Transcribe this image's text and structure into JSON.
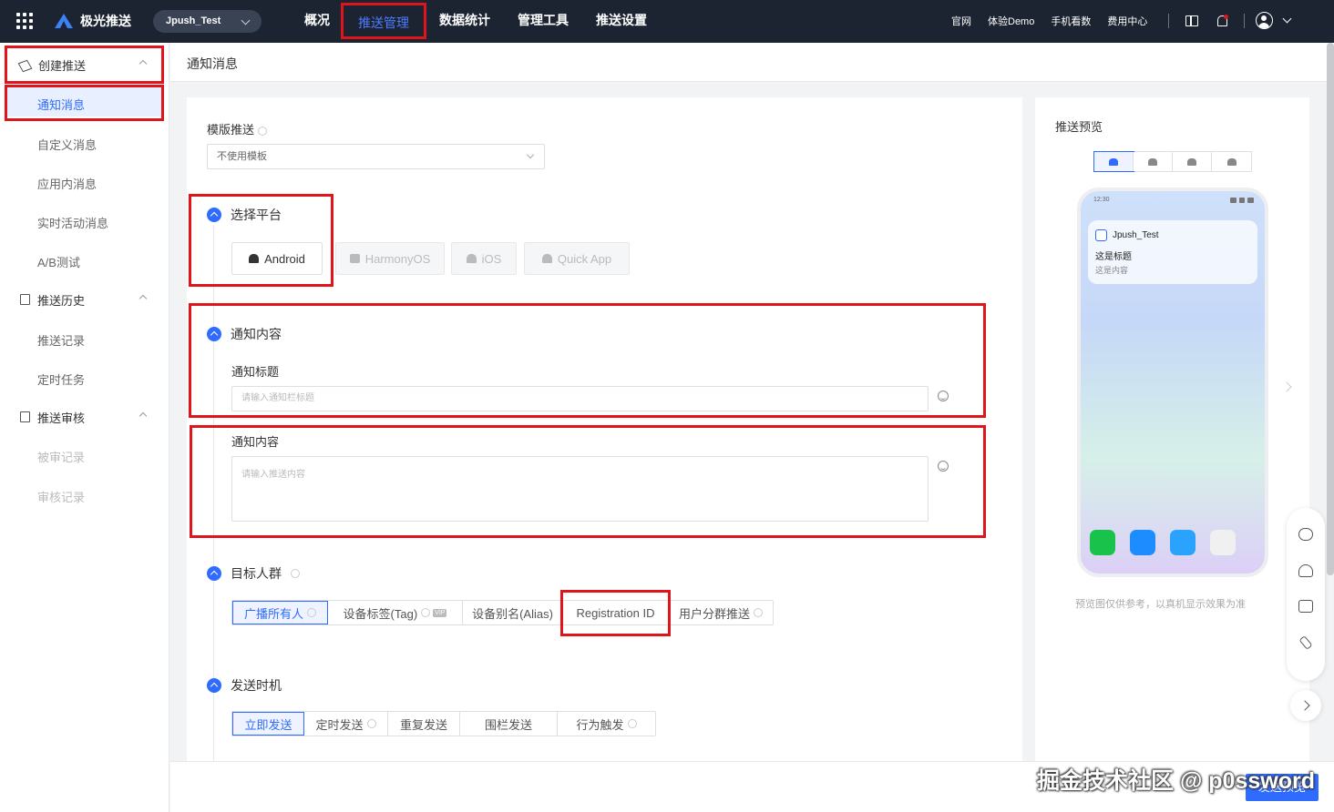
{
  "topbar": {
    "brand": "极光推送",
    "app_select": "Jpush_Test",
    "nav": [
      "概况",
      "推送管理",
      "数据统计",
      "管理工具",
      "推送设置"
    ],
    "links": [
      "官网",
      "体验Demo",
      "手机看数",
      "费用中心"
    ]
  },
  "sidebar": {
    "group1": "创建推送",
    "group1_items": [
      "通知消息",
      "自定义消息",
      "应用内消息",
      "实时活动消息",
      "A/B测试"
    ],
    "group2": "推送历史",
    "group2_items": [
      "推送记录",
      "定时任务"
    ],
    "group3": "推送审核",
    "group3_items": [
      "被审记录",
      "审核记录"
    ]
  },
  "main": {
    "breadcrumb": "通知消息",
    "template_label": "模版推送",
    "template_value": "不使用模板",
    "platform_title": "选择平台",
    "platforms": [
      "Android",
      "HarmonyOS",
      "iOS",
      "Quick App"
    ],
    "content_title": "通知内容",
    "notif_title_label": "通知标题",
    "notif_title_placeholder": "请输入通知栏标题",
    "notif_content_label": "通知内容",
    "notif_content_placeholder": "请输入推送内容",
    "target_title": "目标人群",
    "targets": [
      "广播所有人",
      "设备标签(Tag)",
      "设备别名(Alias)",
      "Registration ID",
      "用户分群推送"
    ],
    "vip": "VIP",
    "time_title": "发送时机",
    "times": [
      "立即发送",
      "定时发送",
      "重复发送",
      "围栏发送",
      "行为触发"
    ]
  },
  "preview": {
    "title": "推送预览",
    "status_time": "12:30",
    "app_name": "Jpush_Test",
    "notif_title": "这是标题",
    "notif_content": "这是内容",
    "note": "预览图仅供参考，以真机显示效果为准"
  },
  "footer": {
    "submit": "发送预览",
    "watermark": "掘金技术社区 @ p0ssword"
  },
  "colors": {
    "accent": "#2f6bff",
    "highlight": "#e0141b",
    "topbar": "#1c2431"
  }
}
